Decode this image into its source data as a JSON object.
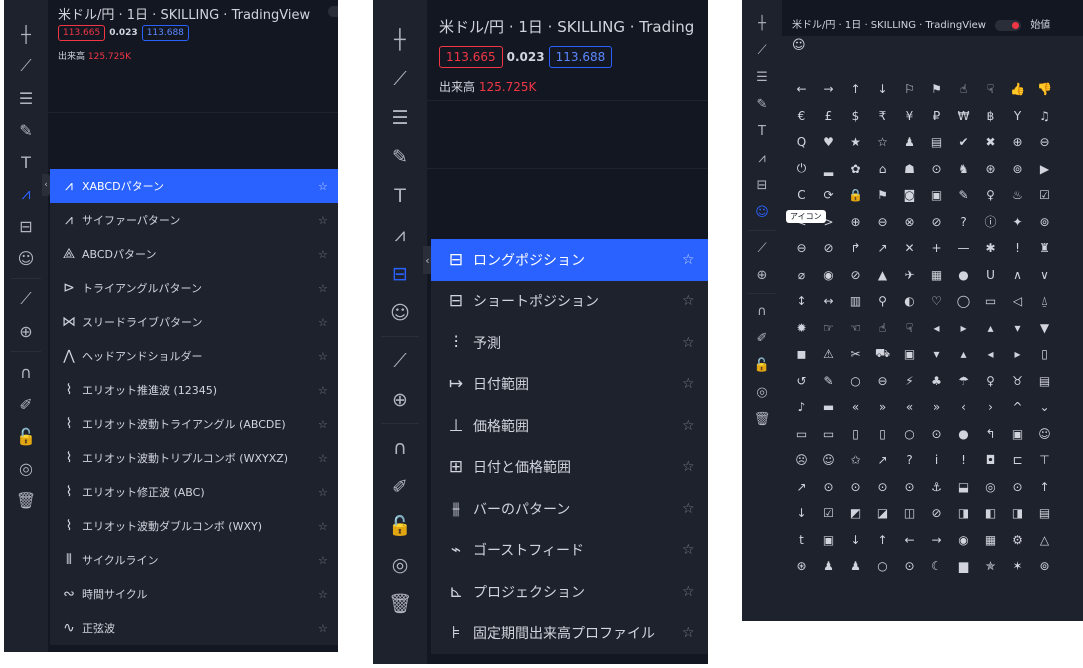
{
  "chart_header": {
    "title_left": "米ドル/円 · 1日 · SKILLING · TradingView",
    "title_mid": "米ドル/円 · 1日 · SKILLING · Trading",
    "title_right": "米ドル/円 · 1日 · SKILLING · TradingView",
    "title_right_suffix": "始値",
    "bid": "113.665",
    "change": "0.023",
    "ask": "113.688",
    "volume_label": "出来高",
    "volume_value": "125.725K"
  },
  "toolbar_icons": [
    "crosshair-icon",
    "trend-line-icon",
    "fib-icon",
    "brush-icon",
    "text-icon",
    "pattern-icon",
    "prediction-icon",
    "emoji-icon",
    "ruler-icon",
    "zoom-in-icon",
    "magnet-icon",
    "pencil-lock-icon",
    "lock-icon",
    "eye-icon",
    "trash-icon"
  ],
  "patterns_menu": [
    {
      "icon": "⩘",
      "label": "XABCDパターン",
      "selected": true
    },
    {
      "icon": "⩘",
      "label": "サイファーパターン"
    },
    {
      "icon": "⟁",
      "label": "ABCDパターン"
    },
    {
      "icon": "⊳",
      "label": "トライアングルパターン"
    },
    {
      "icon": "⋈",
      "label": "スリードライブパターン"
    },
    {
      "icon": "⋀",
      "label": "ヘッドアンドショルダー"
    },
    {
      "icon": "⌇",
      "label": "エリオット推進波 (12345)"
    },
    {
      "icon": "⌇",
      "label": "エリオット波動トライアングル (ABCDE)"
    },
    {
      "icon": "⌇",
      "label": "エリオット波動トリプルコンボ (WXYXZ)"
    },
    {
      "icon": "⌇",
      "label": "エリオット修正波 (ABC)"
    },
    {
      "icon": "⌇",
      "label": "エリオット波動ダブルコンボ (WXY)"
    },
    {
      "icon": "⦀",
      "label": "サイクルライン"
    },
    {
      "icon": "∾",
      "label": "時間サイクル"
    },
    {
      "icon": "∿",
      "label": "正弦波"
    }
  ],
  "prediction_menu": [
    {
      "icon": "⊟",
      "label": "ロングポジション",
      "selected": true
    },
    {
      "icon": "⊟",
      "label": "ショートポジション"
    },
    {
      "icon": "⫶",
      "label": "予測"
    },
    {
      "icon": "↦",
      "label": "日付範囲"
    },
    {
      "icon": "⊥",
      "label": "価格範囲"
    },
    {
      "icon": "⊞",
      "label": "日付と価格範囲"
    },
    {
      "icon": "⫵",
      "label": "バーのパターン"
    },
    {
      "icon": "⌁",
      "label": "ゴーストフィード"
    },
    {
      "icon": "⊾",
      "label": "プロジェクション"
    },
    {
      "icon": "⊧",
      "label": "固定期間出来高プロファイル"
    }
  ],
  "star": "☆",
  "emoji_tab_icon": "☺",
  "emoji_tooltip": "アイコン",
  "emoji_rows": [
    [
      "←",
      "→",
      "↑",
      "↓",
      "⚐",
      "⚑",
      "☝",
      "☟",
      "👍",
      "👎"
    ],
    [
      "€",
      "£",
      "$",
      "₹",
      "¥",
      "₽",
      "₩",
      "฿",
      "Y",
      "♫"
    ],
    [
      "Q",
      "♥",
      "★",
      "☆",
      "♟",
      "▤",
      "✔",
      "✖",
      "⊕",
      "⊖"
    ],
    [
      "⏻",
      "▂",
      "✿",
      "⌂",
      "☗",
      "⊙",
      "♞",
      "⊛",
      "⊚",
      "▶"
    ],
    [
      "C",
      "⟳",
      "🔒",
      "⚑",
      "◙",
      "▣",
      "✎",
      "♀",
      "♨",
      "☑"
    ],
    [
      "<",
      ">",
      "⊕",
      "⊖",
      "⊗",
      "⊘",
      "?",
      "ⓘ",
      "✦",
      "⊚"
    ],
    [
      "⊖",
      "⊘",
      "↱",
      "↗",
      "✕",
      "+",
      "—",
      "✱",
      "!",
      "♜"
    ],
    [
      "⌀",
      "◉",
      "⊘",
      "▲",
      "✈",
      "▦",
      "●",
      "U",
      "∧",
      "∨"
    ],
    [
      "↕",
      "↔",
      "▥",
      "⚲",
      "◐",
      "♡",
      "◯",
      "▭",
      "◁",
      "⍙"
    ],
    [
      "✹",
      "☞",
      "☜",
      "☝",
      "☟",
      "◂",
      "▸",
      "▴",
      "▾",
      "▼"
    ],
    [
      "◼",
      "⚠",
      "✂",
      "⛟",
      "▣",
      "▾",
      "▴",
      "◂",
      "▸",
      "▯"
    ],
    [
      "↺",
      "✎",
      "○",
      "⊖",
      "⚡",
      "♣",
      "☂",
      "♀",
      "♉",
      "▤"
    ],
    [
      "♪",
      "▬",
      "«",
      "»",
      "«",
      "»",
      "‹",
      "›",
      "^",
      "⌄"
    ],
    [
      "▭",
      "▭",
      "▯",
      "▯",
      "○",
      "⊙",
      "●",
      "↰",
      "▣",
      "☺"
    ],
    [
      "☹",
      "☺",
      "✩",
      "↗",
      "?",
      "i",
      "!",
      "◘",
      "⊏",
      "⊤"
    ],
    [
      "↗",
      "⊙",
      "⊙",
      "⊙",
      "⊙",
      "⚓",
      "⬓",
      "◎",
      "⊙",
      "↑"
    ],
    [
      "↓",
      "☑",
      "◩",
      "◪",
      "◫",
      "⊘",
      "◨",
      "◧",
      "◨",
      "▤"
    ],
    [
      "t",
      "▣",
      "↓",
      "↑",
      "←",
      "→",
      "◉",
      "▦",
      "⚙",
      "△"
    ],
    [
      "⊛",
      "♟",
      "♟",
      "○",
      "⊙",
      "☾",
      "▆",
      "✯",
      "✶",
      "⊚"
    ]
  ]
}
